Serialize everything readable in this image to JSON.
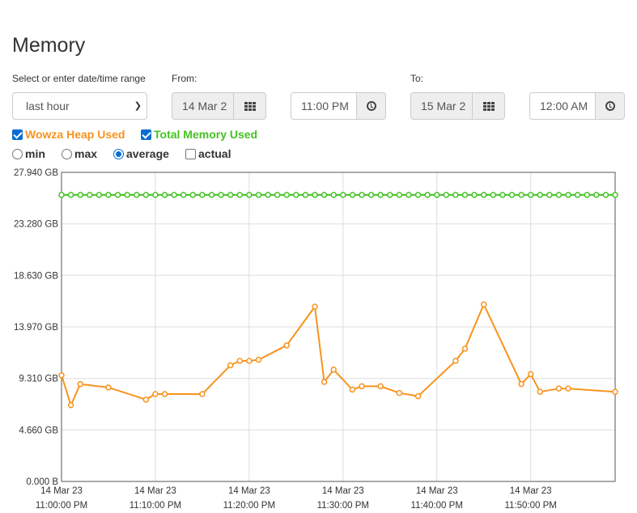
{
  "page": {
    "title": "Memory"
  },
  "range": {
    "label": "Select or enter date/time range",
    "selected": "last hour"
  },
  "from": {
    "label": "From:",
    "date": "14 Mar 2",
    "time": "11:00 PM"
  },
  "to": {
    "label": "To:",
    "date": "15 Mar 2",
    "time": "12:00 AM"
  },
  "series_toggles": [
    {
      "label": "Wowza Heap Used",
      "checked": true,
      "color": "#f7931e"
    },
    {
      "label": "Total Memory Used",
      "checked": true,
      "color": "#44c223"
    }
  ],
  "aggregation": [
    {
      "label": "min",
      "selected": false
    },
    {
      "label": "max",
      "selected": false
    },
    {
      "label": "average",
      "selected": true
    },
    {
      "label": "actual",
      "selected": false
    }
  ],
  "chart_data": {
    "type": "line",
    "title": "",
    "xlabel": "",
    "ylabel": "",
    "ylim": [
      0,
      27.94
    ],
    "xlim_minutes": [
      0,
      59
    ],
    "grid": true,
    "y_ticks": [
      {
        "value": 0,
        "label": "0.000 B"
      },
      {
        "value": 4.66,
        "label": "4.660 GB"
      },
      {
        "value": 9.31,
        "label": "9.310 GB"
      },
      {
        "value": 13.97,
        "label": "13.970 GB"
      },
      {
        "value": 18.63,
        "label": "18.630 GB"
      },
      {
        "value": 23.28,
        "label": "23.280 GB"
      },
      {
        "value": 27.94,
        "label": "27.940 GB"
      }
    ],
    "x_ticks": [
      {
        "minute": 0,
        "date": "14 Mar 23",
        "time": "11:00:00 PM"
      },
      {
        "minute": 10,
        "date": "14 Mar 23",
        "time": "11:10:00 PM"
      },
      {
        "minute": 20,
        "date": "14 Mar 23",
        "time": "11:20:00 PM"
      },
      {
        "minute": 30,
        "date": "14 Mar 23",
        "time": "11:30:00 PM"
      },
      {
        "minute": 40,
        "date": "14 Mar 23",
        "time": "11:40:00 PM"
      },
      {
        "minute": 50,
        "date": "14 Mar 23",
        "time": "11:50:00 PM"
      }
    ],
    "series": [
      {
        "name": "Wowza Heap Used",
        "color": "#f7931e",
        "minutes": [
          0,
          1,
          2,
          5,
          9,
          10,
          11,
          15,
          18,
          19,
          20,
          21,
          24,
          27,
          28,
          29,
          31,
          32,
          34,
          36,
          38,
          42,
          43,
          45,
          49,
          50,
          51,
          53,
          54,
          59
        ],
        "values": [
          9.6,
          6.9,
          8.8,
          8.5,
          7.4,
          7.9,
          7.9,
          7.9,
          10.5,
          10.9,
          10.9,
          11.0,
          12.3,
          15.8,
          9.0,
          10.1,
          8.3,
          8.6,
          8.6,
          8.0,
          7.7,
          10.9,
          12.0,
          16.0,
          8.8,
          9.7,
          8.1,
          8.4,
          8.4,
          8.1
        ]
      },
      {
        "name": "Total Memory Used",
        "color": "#44c223",
        "minutes": [
          0,
          1,
          2,
          3,
          4,
          5,
          6,
          7,
          8,
          9,
          10,
          11,
          12,
          13,
          14,
          15,
          16,
          17,
          18,
          19,
          20,
          21,
          22,
          23,
          24,
          25,
          26,
          27,
          28,
          29,
          30,
          31,
          32,
          33,
          34,
          35,
          36,
          37,
          38,
          39,
          40,
          41,
          42,
          43,
          44,
          45,
          46,
          47,
          48,
          49,
          50,
          51,
          52,
          53,
          54,
          55,
          56,
          57,
          58,
          59
        ],
        "values": [
          25.9,
          25.9,
          25.9,
          25.9,
          25.9,
          25.9,
          25.9,
          25.9,
          25.9,
          25.9,
          25.9,
          25.9,
          25.9,
          25.9,
          25.9,
          25.9,
          25.9,
          25.9,
          25.9,
          25.9,
          25.9,
          25.9,
          25.9,
          25.9,
          25.9,
          25.9,
          25.9,
          25.9,
          25.9,
          25.9,
          25.9,
          25.9,
          25.9,
          25.9,
          25.9,
          25.9,
          25.9,
          25.9,
          25.9,
          25.9,
          25.9,
          25.9,
          25.9,
          25.9,
          25.9,
          25.9,
          25.9,
          25.9,
          25.9,
          25.9,
          25.9,
          25.9,
          25.9,
          25.9,
          25.9,
          25.9,
          25.9,
          25.9,
          25.9,
          25.9
        ]
      }
    ]
  }
}
